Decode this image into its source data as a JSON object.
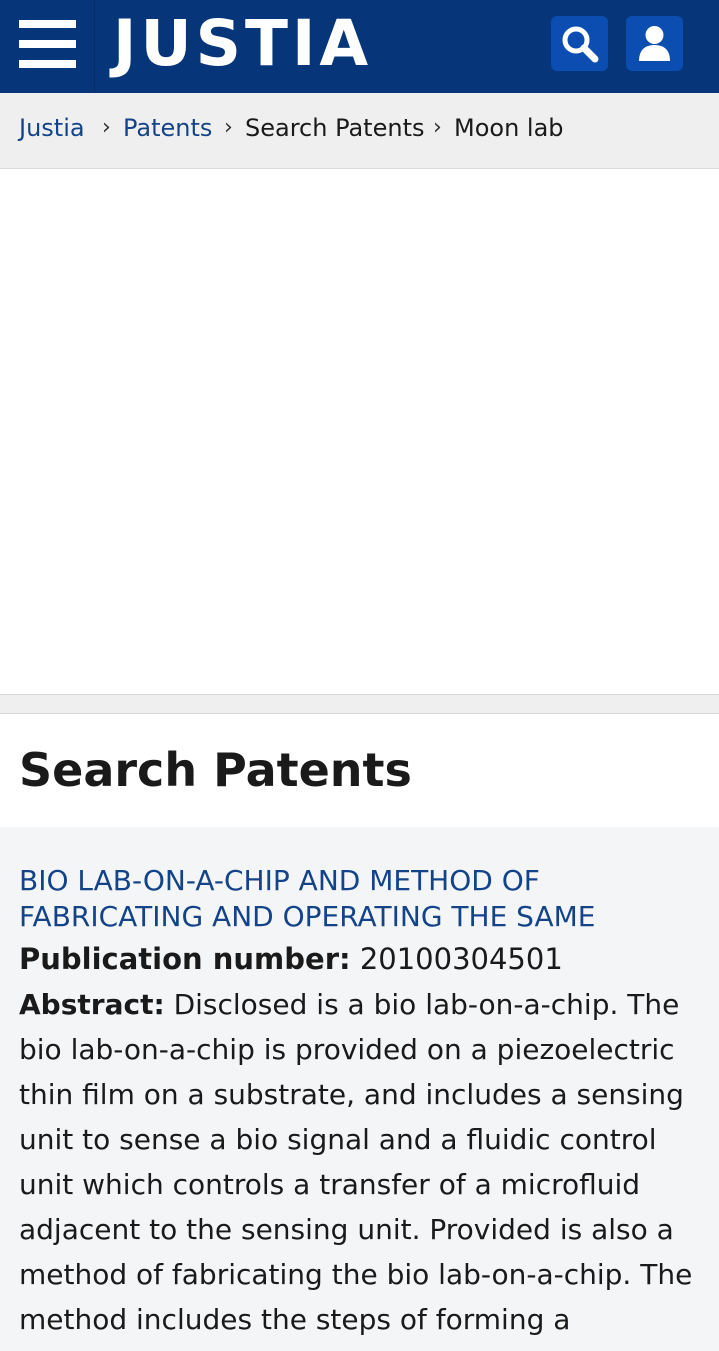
{
  "header": {
    "logo_text": "JUSTIA",
    "menu_icon": "hamburger-menu-icon",
    "search_icon": "search-icon",
    "account_icon": "user-icon",
    "background": "#06357a",
    "button_color": "#0b4db0"
  },
  "breadcrumb": {
    "items": [
      {
        "label": "Justia",
        "is_link": true
      },
      {
        "label": "Patents",
        "is_link": true
      },
      {
        "label": "Search Patents",
        "is_link": false
      },
      {
        "label": "Moon lab",
        "is_link": false
      }
    ],
    "separator": "›"
  },
  "main": {
    "title": "Search Patents",
    "results": [
      {
        "title": "BIO LAB-ON-A-CHIP AND METHOD OF FABRICATING AND OPERATING THE SAME",
        "publication_label": "Publication number:",
        "publication_number": "20100304501",
        "abstract_label": "Abstract:",
        "abstract_text": "Disclosed is a bio lab-on-a-chip. The bio lab-on-a-chip is provided on a piezoelectric thin film on a substrate, and includes a sensing unit to sense a bio signal and a fluidic control unit which controls a transfer of a microfluid adjacent to the sensing unit. Provided is also a method of fabricating the bio lab-on-a-chip. The method includes the steps of forming a"
      }
    ]
  },
  "colors": {
    "link": "#13448a",
    "breadcrumb_bg": "#efefef",
    "results_bg": "#f4f5f7"
  }
}
